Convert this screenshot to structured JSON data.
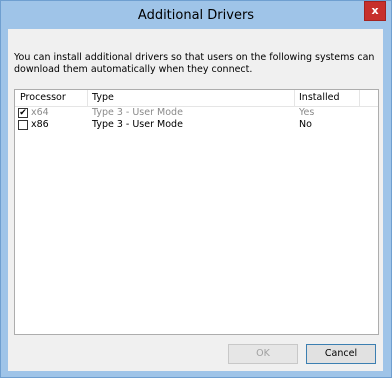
{
  "window": {
    "title": "Additional Drivers",
    "close_label": "x"
  },
  "description": "You can install additional drivers so that users on the following systems can download them automatically when they connect.",
  "table": {
    "columns": [
      "Processor",
      "Type",
      "Installed"
    ],
    "rows": [
      {
        "checked": true,
        "processor": "x64",
        "type": "Type 3 - User Mode",
        "installed": "Yes",
        "dimmed": true
      },
      {
        "checked": false,
        "processor": "x86",
        "type": "Type 3 - User Mode",
        "installed": "No",
        "dimmed": false
      }
    ]
  },
  "buttons": {
    "ok": "OK",
    "cancel": "Cancel"
  },
  "check_glyph": "✔"
}
